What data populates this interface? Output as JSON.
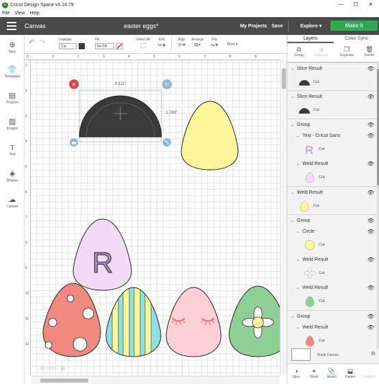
{
  "app": {
    "title": "Cricut Design Space  v5.14.79",
    "logo": "C"
  },
  "menu": [
    "File",
    "View",
    "Help"
  ],
  "window_controls": [
    "—",
    "☐",
    "✕"
  ],
  "header": {
    "section": "Canvas",
    "document": "easter eggs*",
    "my_projects": "My Projects",
    "save": "Save",
    "machine": "Explore",
    "make_it": "Make It"
  },
  "toolbar": {
    "linetype_label": "Linetype",
    "linetype_value": "Cut",
    "fill_label": "Fill",
    "fill_value": "No Fill",
    "select_all": "Select All",
    "edit": "Edit",
    "align": "Align",
    "arrange": "Arrange",
    "flip": "Flip",
    "more": "More"
  },
  "left_nav": [
    {
      "label": "New",
      "icon": "plus-icon"
    },
    {
      "label": "Templates",
      "icon": "shirt-icon"
    },
    {
      "label": "Projects",
      "icon": "projects-icon"
    },
    {
      "label": "Images",
      "icon": "image-icon"
    },
    {
      "label": "Text",
      "icon": "text-icon"
    },
    {
      "label": "Shapes",
      "icon": "shapes-icon"
    },
    {
      "label": "Upload",
      "icon": "upload-icon"
    }
  ],
  "ruler": {
    "x": [
      "0",
      "1",
      "2",
      "3",
      "4",
      "5",
      "6",
      "7",
      "8",
      "9"
    ],
    "y": [
      "1",
      "2",
      "3",
      "4",
      "5",
      "6",
      "7",
      "8",
      "9",
      "10",
      "11",
      "12"
    ]
  },
  "selection": {
    "width": "3.111\"",
    "height": "1.763\""
  },
  "zoom": "100%",
  "egg_letter": "R",
  "panel": {
    "tabs": [
      "Layers",
      "Color Sync"
    ],
    "actions": [
      "Group",
      "UnGroup",
      "Duplicate",
      "Delete"
    ],
    "layers": [
      {
        "name": "Slice Result",
        "op": "Cut",
        "thumb": "half-dome",
        "color": "#3a3a3a"
      },
      {
        "name": "Slice Result",
        "op": "Cut",
        "thumb": "half-dome",
        "color": "#3a3a3a"
      },
      {
        "name": "Group"
      },
      {
        "name": "Text - Cricut Sans",
        "op": "Cut",
        "thumb": "letter-r",
        "color": "#b78fd6"
      },
      {
        "name": "Weld Result",
        "op": "Cut",
        "thumb": "egg",
        "color": "#f4dcf8"
      },
      {
        "name": "Weld Result",
        "op": "Cut",
        "thumb": "egg",
        "color": "#fcf59a"
      },
      {
        "name": "Group"
      },
      {
        "name": "Circle",
        "op": "Cut",
        "thumb": "circle",
        "color": "#fcf59a"
      },
      {
        "name": "Weld Result",
        "op": "Cut",
        "thumb": "flower",
        "color": "#ffffff"
      },
      {
        "name": "Weld Result",
        "op": "Cut",
        "thumb": "egg",
        "color": "#8fcf95"
      },
      {
        "name": "Group"
      },
      {
        "name": "Weld Result",
        "op": "Cut",
        "thumb": "egg",
        "color": "#f08a80"
      }
    ],
    "blank_canvas": "Blank Canvas",
    "bottom_actions": [
      "Slice",
      "Weld",
      "Attach",
      "Flatten",
      "Contour"
    ]
  },
  "colors": {
    "header_bg": "#4a4a4a",
    "make_it": "#33a852",
    "dome": "#3a3a3a",
    "egg_yellow": "#fcf59a",
    "egg_lilac": "#f4dcf8",
    "egg_red": "#f08a80",
    "egg_blue": "#8ee0e8",
    "egg_pink": "#fdd0d8",
    "egg_green": "#8fcf95"
  }
}
